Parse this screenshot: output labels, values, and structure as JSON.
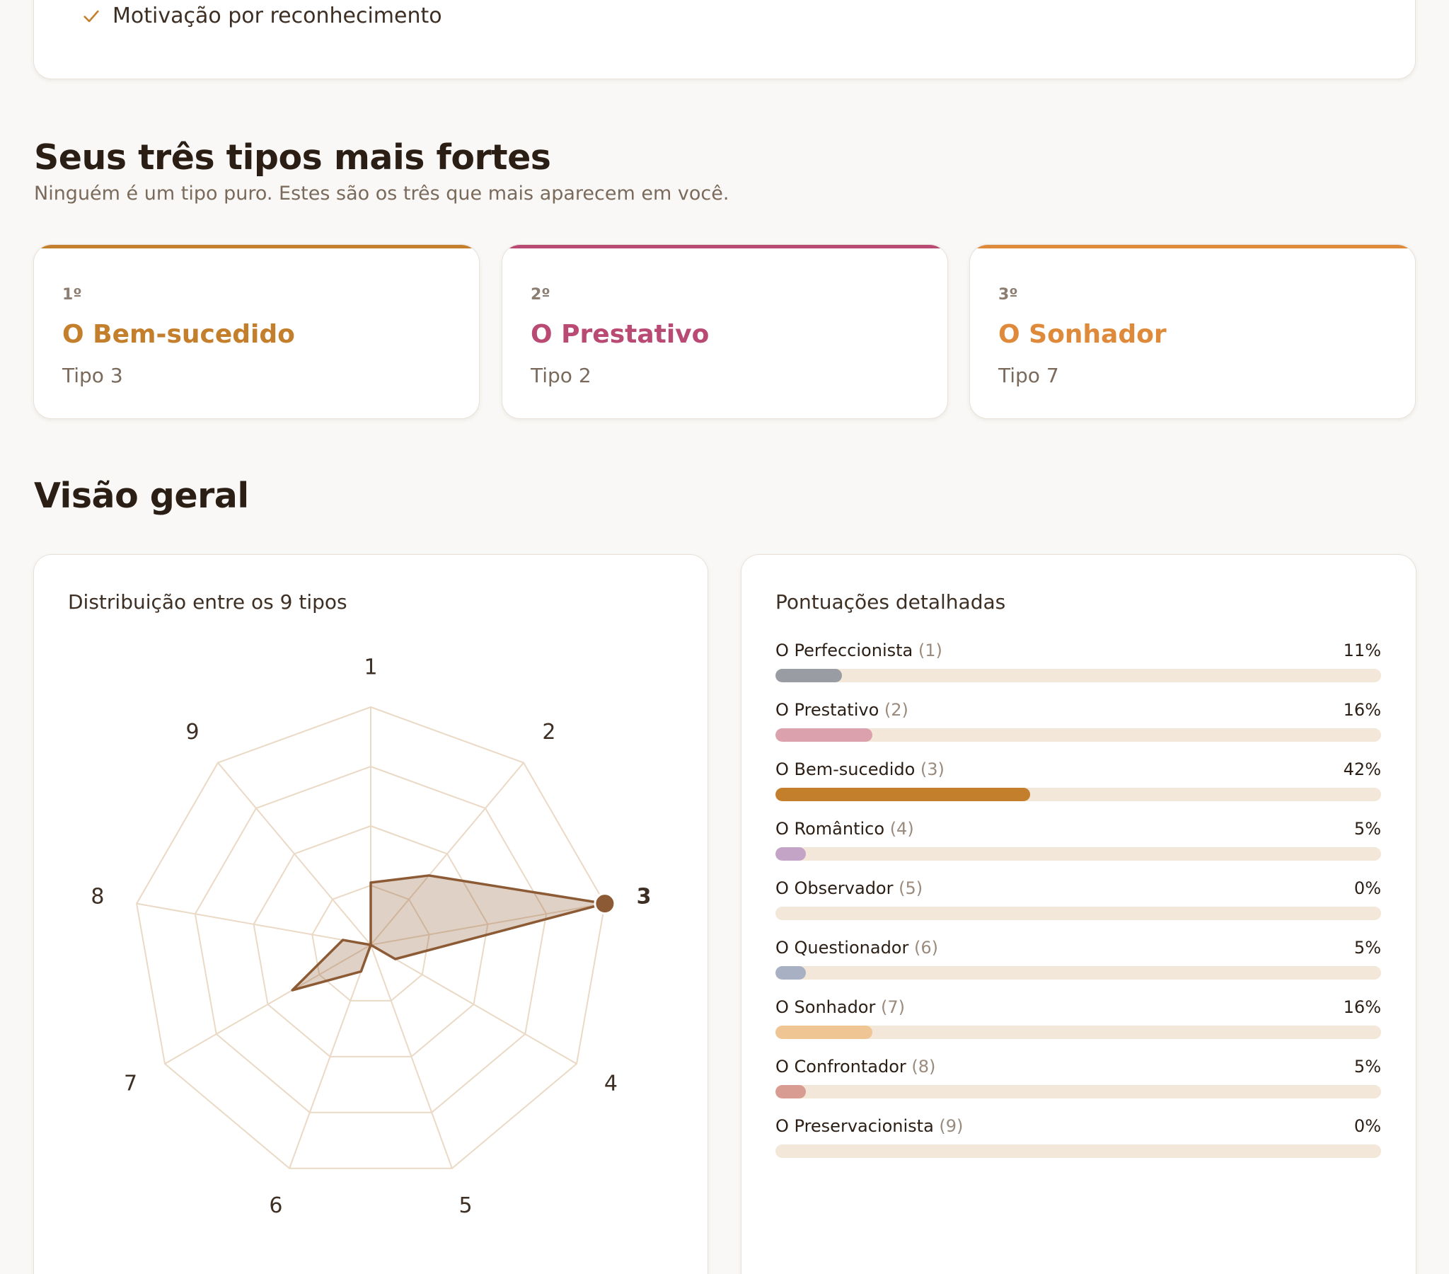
{
  "top_card": {
    "item_label": "Motivação por reconhecimento"
  },
  "top_types": {
    "title": "Seus três tipos mais fortes",
    "subtitle": "Ninguém é um tipo puro. Estes são os três que mais aparecem em você.",
    "cards": [
      {
        "rank": "1º",
        "name": "O Bem-sucedido",
        "sub": "Tipo 3",
        "color": "#c47f2c"
      },
      {
        "rank": "2º",
        "name": "O Prestativo",
        "sub": "Tipo 2",
        "color": "#b94a73"
      },
      {
        "rank": "3º",
        "name": "O Sonhador",
        "sub": "Tipo 7",
        "color": "#de8a3a"
      }
    ]
  },
  "overview": {
    "title": "Visão geral",
    "radar_title": "Distribuição entre os 9 tipos",
    "bars_title": "Pontuações detalhadas"
  },
  "chart_data": [
    {
      "type": "radar",
      "title": "Distribuição entre os 9 tipos",
      "categories": [
        "1",
        "2",
        "3",
        "4",
        "5",
        "6",
        "7",
        "8",
        "9"
      ],
      "values": [
        11,
        16,
        42,
        5,
        0,
        5,
        16,
        5,
        0
      ],
      "rmax": 42,
      "rings": 4,
      "highlight_category": "3",
      "colors": {
        "grid": "#ead9c5",
        "line": "#8c5a34",
        "fill": "rgba(140,90,52,0.28)",
        "label": "#3d2f24"
      }
    },
    {
      "type": "bar",
      "title": "Pontuações detalhadas",
      "series": [
        {
          "name": "O Perfeccionista",
          "num": "(1)",
          "value": 11,
          "pct": "11%",
          "color": "#9a9ca3"
        },
        {
          "name": "O Prestativo",
          "num": "(2)",
          "value": 16,
          "pct": "16%",
          "color": "#dba2ad"
        },
        {
          "name": "O Bem-sucedido",
          "num": "(3)",
          "value": 42,
          "pct": "42%",
          "color": "#c47f2c"
        },
        {
          "name": "O Romântico",
          "num": "(4)",
          "value": 5,
          "pct": "5%",
          "color": "#c3a3c6"
        },
        {
          "name": "O Observador",
          "num": "(5)",
          "value": 0,
          "pct": "0%",
          "color": "#8fa2b8"
        },
        {
          "name": "O Questionador",
          "num": "(6)",
          "value": 5,
          "pct": "5%",
          "color": "#a8b1c4"
        },
        {
          "name": "O Sonhador",
          "num": "(7)",
          "value": 16,
          "pct": "16%",
          "color": "#f0c594"
        },
        {
          "name": "O Confrontador",
          "num": "(8)",
          "value": 5,
          "pct": "5%",
          "color": "#d99c92"
        },
        {
          "name": "O Preservacionista",
          "num": "(9)",
          "value": 0,
          "pct": "0%",
          "color": "#a7b89e"
        }
      ],
      "xlim": [
        0,
        100
      ]
    }
  ]
}
